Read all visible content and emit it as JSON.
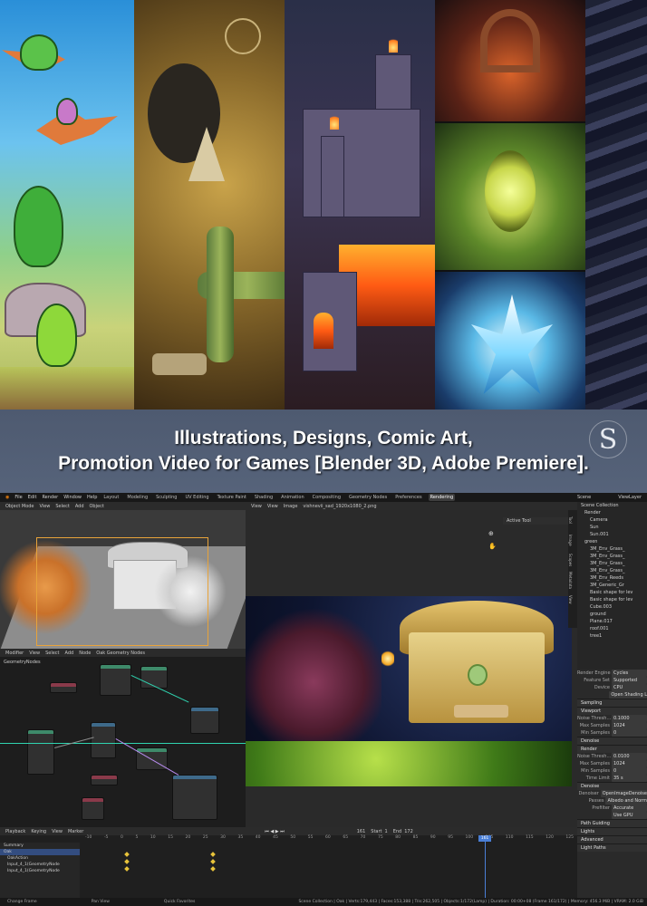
{
  "banner": {
    "line1": "Illustrations, Designs, Comic Art,",
    "line2": "Promotion Video for Games [Blender 3D, Adobe Premiere].",
    "logo_text": "S"
  },
  "blender": {
    "menus": [
      "File",
      "Edit",
      "Render",
      "Window",
      "Help"
    ],
    "workspaces": [
      "Layout",
      "Modeling",
      "Sculpting",
      "UV Editing",
      "Texture Paint",
      "Shading",
      "Animation",
      "Compositing",
      "Geometry Nodes",
      "Preferences",
      "Rendering"
    ],
    "active_workspace": "Rendering",
    "scene_label": "Scene",
    "viewlayer_label": "ViewLayer",
    "viewport_header": [
      "Object Mode",
      "View",
      "Select",
      "Add",
      "Object"
    ],
    "image_header": [
      "View",
      "View",
      "Image"
    ],
    "image_name": "vishnevii_sad_1920x1080_2.png",
    "active_tool": "Active Tool",
    "node_header": [
      "Modifier",
      "View",
      "Select",
      "Add",
      "Node"
    ],
    "node_tree": "Oak Geometry Nodes",
    "node_breadcrumb": "GeometryNodes",
    "side_tabs": [
      "Tool",
      "Image",
      "Scopes",
      "Metadata",
      "View"
    ],
    "outliner": {
      "header": "Scene Collection",
      "rows": [
        "Render",
        "Camera",
        "Sun",
        "Sun.001",
        "green",
        "3M_Env_Grass_",
        "3M_Env_Grass_",
        "3M_Env_Grass_",
        "3M_Env_Grass_",
        "3M_Env_Reeds",
        "3M_Generic_Gr",
        "Basic shape for lev",
        "Basic shape for lev",
        "Cube.003",
        "ground",
        "Plane.017",
        "roof.001",
        "tree1"
      ]
    },
    "properties": {
      "render_engine_label": "Render Engine",
      "render_engine": "Cycles",
      "feature_set_label": "Feature Set",
      "feature_set": "Supported",
      "device_label": "Device",
      "device": "CPU",
      "open_shading": "Open Shading L",
      "sampling": "Sampling",
      "viewport": "Viewport",
      "noise_threshold_label": "Noise Thresh...",
      "noise_threshold_vp": "0.1000",
      "max_samples_label": "Max Samples",
      "max_samples_vp": "1024",
      "min_samples_label": "Min Samples",
      "min_samples_vp": "0",
      "denoise": "Denoise",
      "render": "Render",
      "noise_threshold_r": "0.0100",
      "max_samples_r": "1024",
      "min_samples_r": "0",
      "time_limit_label": "Time Limit",
      "time_limit": "35 s",
      "denoise_r": "Denoise",
      "denoiser_label": "Denoiser",
      "denoiser": "OpenImageDenoise",
      "passes_label": "Passes",
      "passes": "Albedo and Norm",
      "prefilter_label": "Prefilter",
      "prefilter": "Accurate",
      "use_gpu": "Use GPU",
      "path_guiding": "Path Guiding",
      "lights": "Lights",
      "advanced": "Advanced",
      "light_paths": "Light Paths"
    },
    "timeline": {
      "header": [
        "Playback",
        "Keying",
        "View",
        "Marker"
      ],
      "current_frame": "161",
      "start_label": "Start",
      "start": "1",
      "end_label": "End",
      "end": "172",
      "ticks": [
        "-10",
        "-5",
        "0",
        "5",
        "10",
        "15",
        "20",
        "25",
        "30",
        "35",
        "40",
        "45",
        "50",
        "55",
        "60",
        "65",
        "70",
        "75",
        "80",
        "85",
        "90",
        "95",
        "100",
        "105",
        "110",
        "115",
        "120",
        "125"
      ],
      "rows": [
        "Summary",
        "Oak",
        "OakAction",
        "Input_4_1(GeometryNode",
        "Input_4_1(GeometryNode"
      ]
    },
    "status": {
      "left": [
        "Change Frame",
        "Pan View",
        "Quick Favorites"
      ],
      "right": "Scene Collection | Oak | Verts:179,443 | Faces:153,388 | Tris:262,505 | Objects:1/172(Lamp) | Duration: 00:00+08 (Frame 161/172) | Memory: 456.3 MiB | VRAM: 2.0 GiB"
    }
  }
}
